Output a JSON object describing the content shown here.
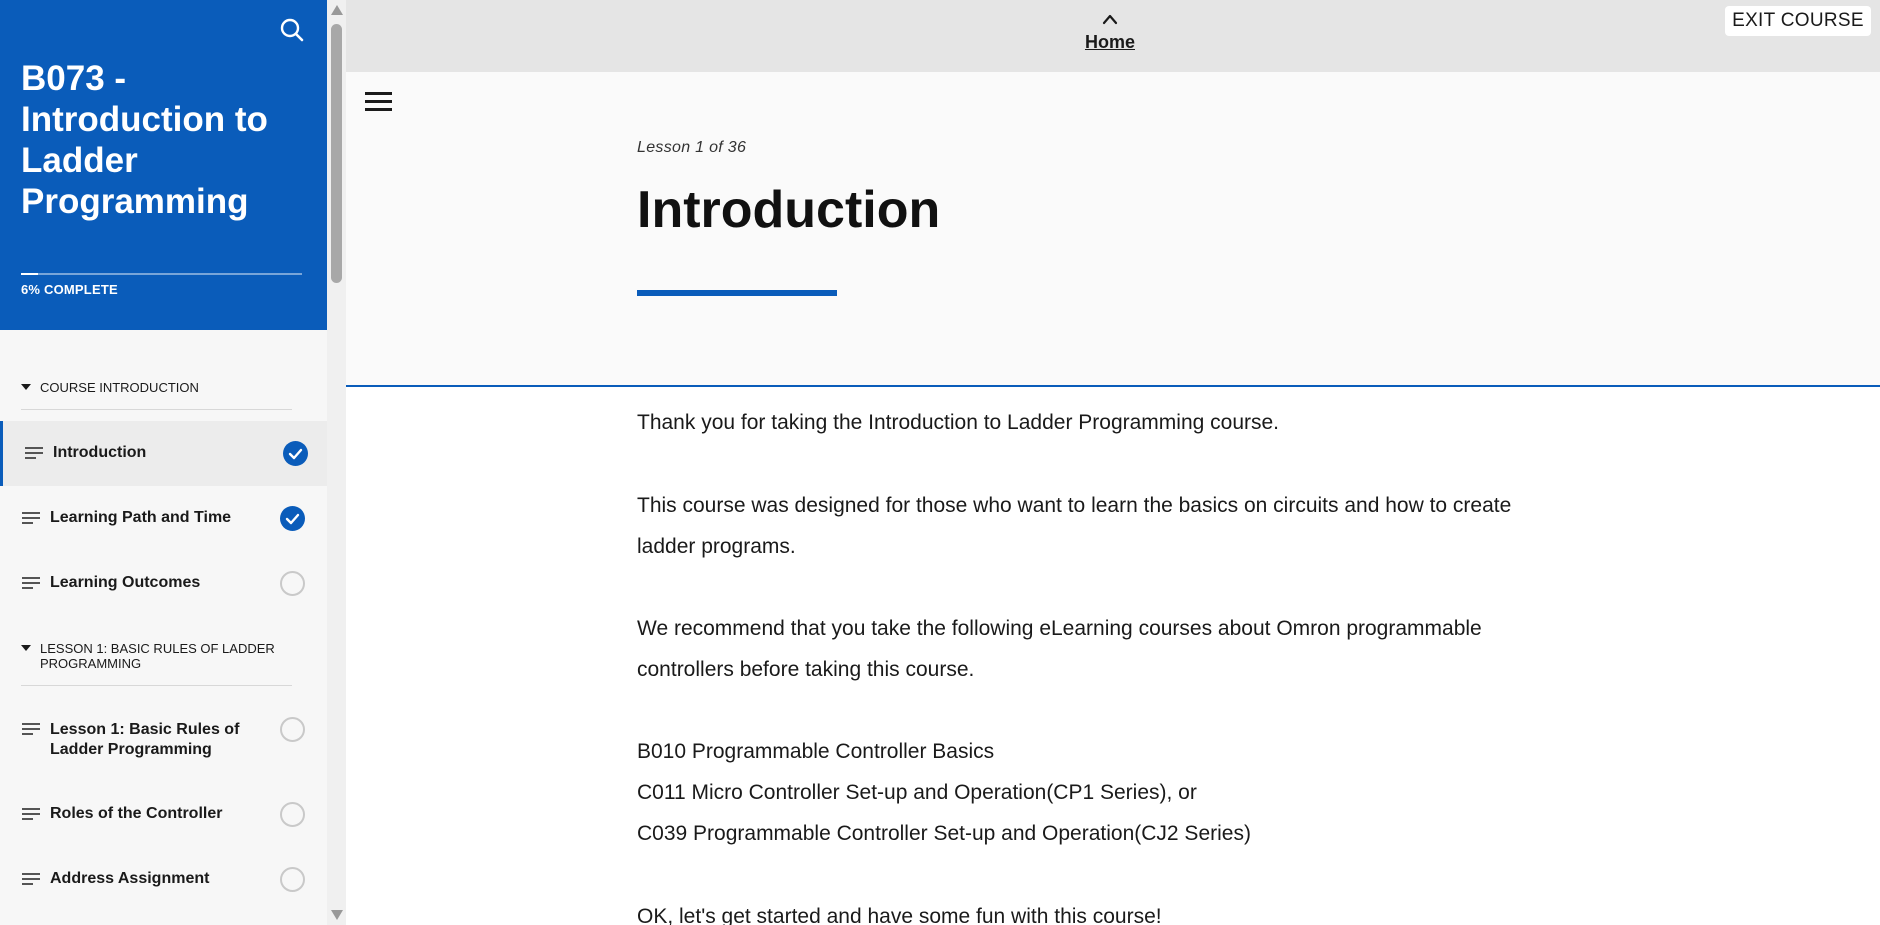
{
  "sidebar": {
    "course_title": "B073 - Introduction to Ladder Programming",
    "progress": {
      "percent": 6,
      "label": "6% COMPLETE"
    },
    "sections": [
      {
        "title": "COURSE INTRODUCTION",
        "lessons": [
          {
            "label": "Introduction",
            "status": "complete",
            "active": true
          },
          {
            "label": "Learning Path and Time",
            "status": "complete",
            "active": false
          },
          {
            "label": "Learning Outcomes",
            "status": "incomplete",
            "active": false
          }
        ]
      },
      {
        "title": "LESSON 1: BASIC RULES OF LADDER PROGRAMMING",
        "lessons": [
          {
            "label": "Lesson 1: Basic Rules of Ladder Programming",
            "status": "incomplete",
            "active": false
          },
          {
            "label": "Roles of the Controller",
            "status": "incomplete",
            "active": false
          },
          {
            "label": "Address Assignment",
            "status": "incomplete",
            "active": false
          }
        ]
      }
    ]
  },
  "icons": {
    "search": "search-icon",
    "menu": "hamburger-menu-icon",
    "home": "chevron-up-icon",
    "lesson": "lesson-lines-icon",
    "complete": "check-circle-icon",
    "incomplete": "empty-circle-icon"
  },
  "colors": {
    "accent": "#0a5cba",
    "topbar": "#e5e5e5",
    "header_bg": "#fafafa"
  },
  "topbar": {
    "home_label": "Home",
    "exit_label": "EXIT COURSE"
  },
  "lesson": {
    "counter": "Lesson 1 of 36",
    "title": "Introduction",
    "paragraphs": [
      "Thank you for taking the Introduction to Ladder Programming course.",
      "This course was designed for those who want to learn the basics on circuits and how to create ladder programs.",
      "We recommend that you take the following eLearning courses about Omron programmable controllers before taking this course.",
      "B010 Programmable Controller Basics",
      "C011 Micro Controller Set-up and Operation(CP1 Series), or",
      "C039 Programmable Controller Set-up and Operation(CJ2 Series)",
      "OK, let's get started and have some fun with this course!"
    ]
  }
}
